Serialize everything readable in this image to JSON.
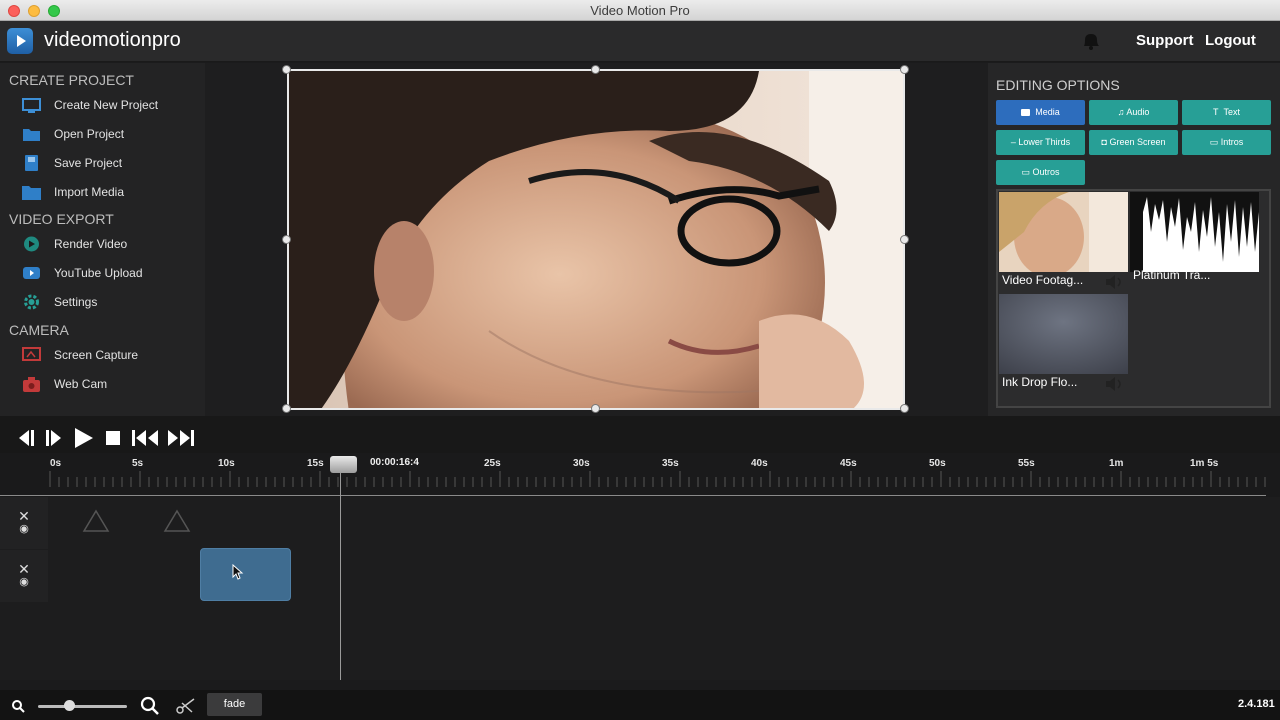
{
  "window": {
    "title": "Video Motion Pro"
  },
  "header": {
    "brand": "videomotionpro",
    "support_label": "Support",
    "logout_label": "Logout"
  },
  "sidebar": {
    "sections": [
      {
        "title": "CREATE PROJECT",
        "items": [
          "Create New Project",
          "Open Project",
          "Save Project",
          "Import Media"
        ]
      },
      {
        "title": "VIDEO EXPORT",
        "items": [
          "Render Video",
          "YouTube Upload",
          "Settings"
        ]
      },
      {
        "title": "CAMERA",
        "items": [
          "Screen Capture",
          "Web Cam"
        ]
      }
    ]
  },
  "editing": {
    "title": "EDITING OPTIONS",
    "buttons": [
      "Media",
      "Audio",
      "Text",
      "Lower Thirds",
      "Green Screen",
      "Intros",
      "Outros"
    ],
    "active_button": "Media",
    "media": [
      "Video Footag...",
      "Platinum Tra...",
      "Ink Drop Flo..."
    ]
  },
  "timeline": {
    "ticks": [
      "0s",
      "5s",
      "10s",
      "15s",
      "25s",
      "30s",
      "35s",
      "40s",
      "45s",
      "50s",
      "55s",
      "1m",
      "1m 5s"
    ],
    "playhead_time": "00:00:16:4",
    "clip_label": ""
  },
  "bottom": {
    "fade_label": "fade",
    "version": "2.4.181"
  },
  "colors": {
    "accent_teal": "#279f96",
    "accent_blue": "#2d6dbd",
    "clip": "#3f6c90"
  }
}
